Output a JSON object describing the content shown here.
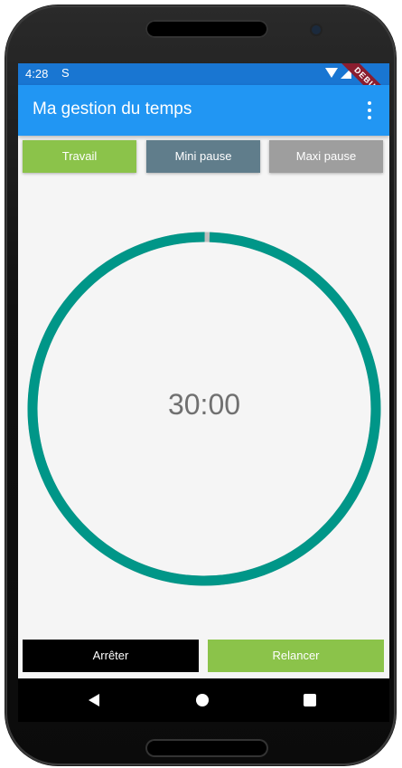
{
  "status_bar": {
    "time": "4:28",
    "sim_glyph": "S",
    "debug_label": "DEBUG",
    "icons": [
      "wifi-icon",
      "signal-icon",
      "battery-icon"
    ]
  },
  "app_bar": {
    "title": "Ma gestion du temps",
    "menu_icon": "more-vert-icon"
  },
  "modes": [
    {
      "label": "Travail",
      "color": "#8bc34a"
    },
    {
      "label": "Mini pause",
      "color": "#607d8b"
    },
    {
      "label": "Maxi pause",
      "color": "#9e9e9e"
    }
  ],
  "timer": {
    "display": "30:00",
    "progress": 0.995,
    "ring_color": "#009688",
    "track_color": "#bdbdbd"
  },
  "actions": {
    "stop_label": "Arrêter",
    "stop_color": "#000000",
    "restart_label": "Relancer",
    "restart_color": "#8bc34a"
  },
  "nav_bar": {
    "icons": [
      "back-icon",
      "home-icon",
      "recents-icon"
    ]
  },
  "colors": {
    "status_bar": "#1976d2",
    "app_bar": "#2196f3",
    "background": "#f5f5f5"
  }
}
